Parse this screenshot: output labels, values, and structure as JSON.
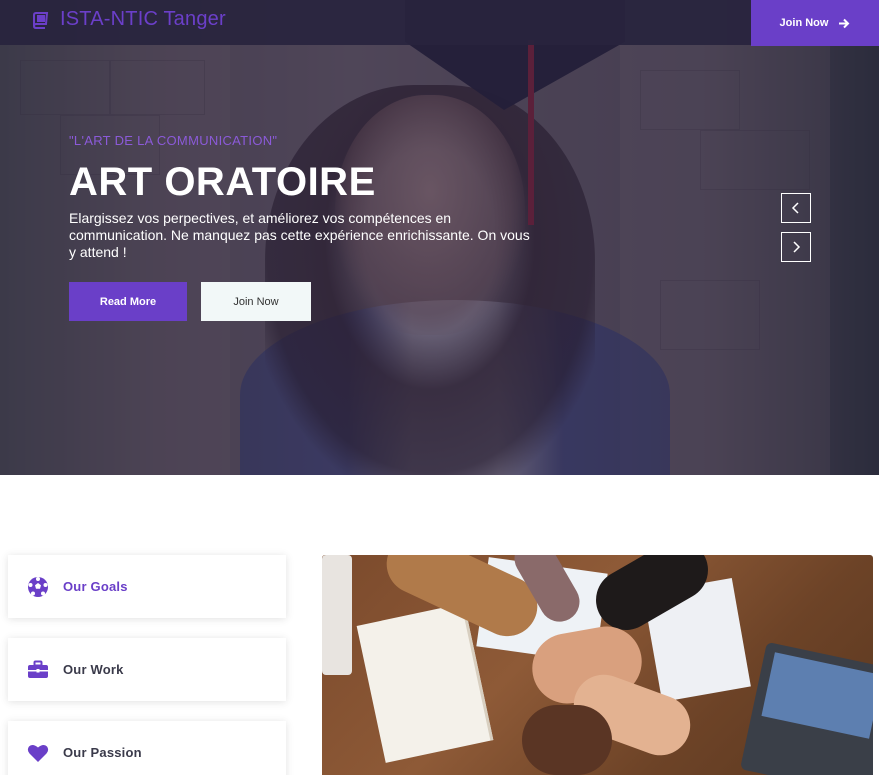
{
  "navbar": {
    "brand": "ISTA-NTIC Tanger",
    "join_label": "Join Now"
  },
  "hero": {
    "eyebrow": "\"L'ART DE LA COMMUNICATION\"",
    "title": "ART ORATOIRE",
    "description": "Elargissez vos perpectives, et améliorez vos compétences en communication. Ne manquez pas cette expérience enrichissante. On vous y attend !",
    "read_more_label": "Read More",
    "join_label": "Join Now"
  },
  "features": [
    {
      "label": "Our Goals",
      "icon": "soccer-ball-icon"
    },
    {
      "label": "Our Work",
      "icon": "briefcase-icon"
    },
    {
      "label": "Our Passion",
      "icon": "heart-icon"
    }
  ],
  "colors": {
    "accent": "#6a3fc8",
    "navbar_bg": "#28243e",
    "text_dark": "#3a3a4a"
  }
}
